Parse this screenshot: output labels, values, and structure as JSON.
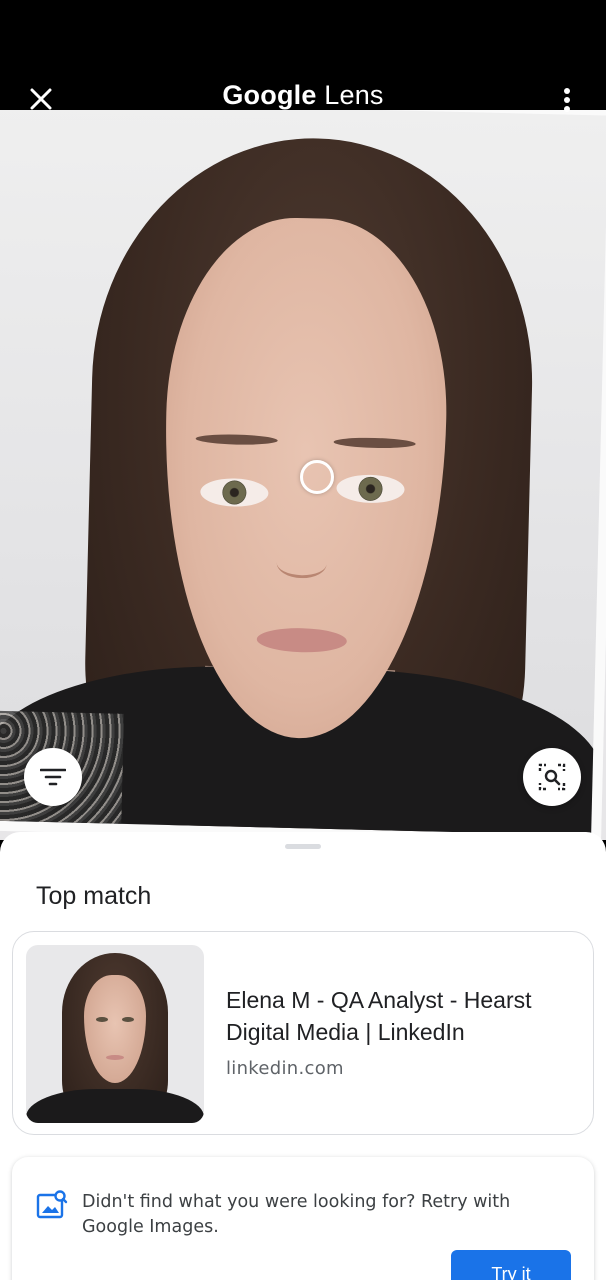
{
  "header": {
    "title_brand": "Google",
    "title_product": "Lens",
    "close_icon": "close-icon",
    "menu_icon": "more-vert-icon"
  },
  "viewer": {
    "filter_icon": "filter-icon",
    "search_region_icon": "image-search-icon"
  },
  "results": {
    "section_title": "Top match",
    "top_match": {
      "title": "Elena M - QA Analyst - Hearst Digital Media | LinkedIn",
      "source": "linkedin.com"
    },
    "retry": {
      "message": "Didn't find what you were looking for? Retry with Google Images.",
      "button_label": "Try it"
    }
  },
  "colors": {
    "accent": "#1a73e8",
    "text_primary": "#202124",
    "text_secondary": "#5f6368"
  }
}
